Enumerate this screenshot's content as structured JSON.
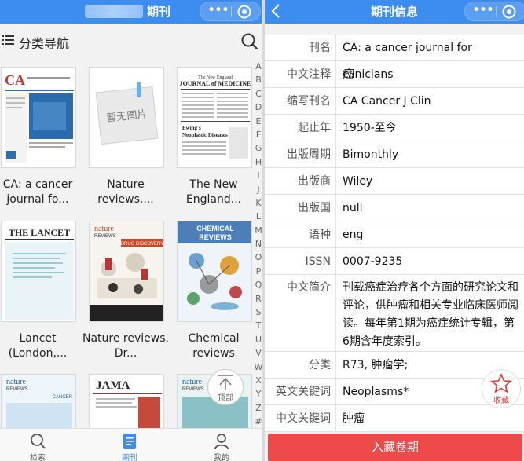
{
  "left": {
    "header": {
      "title": "期刊"
    },
    "nav": {
      "title": "分类导航"
    },
    "journals": [
      {
        "caption": "CA: a cancer journal fo...",
        "cover": "CA"
      },
      {
        "caption": "Nature reviews....",
        "cover": "暂无图片"
      },
      {
        "caption": "The New England...",
        "cover": "The New England JOURNAL of MEDICINE"
      },
      {
        "caption": "Lancet (London,...",
        "cover": "THE LANCET"
      },
      {
        "caption": "Nature reviews. Dr...",
        "cover": "nature REVIEWS DRUG DISCOVERY"
      },
      {
        "caption": "Chemical reviews",
        "cover": "CHEMICAL REVIEWS"
      },
      {
        "caption": "",
        "cover": "nature REVIEWS CANCER"
      },
      {
        "caption": "",
        "cover": "JAMA"
      },
      {
        "caption": "",
        "cover": "nature REVIEWS"
      }
    ],
    "ewing": "Ewing's Neoplastic Diseases",
    "alphabet": [
      "A",
      "B",
      "C",
      "D",
      "E",
      "F",
      "G",
      "H",
      "I",
      "J",
      "K",
      "L",
      "M",
      "N",
      "O",
      "P",
      "Q",
      "R",
      "S",
      "T",
      "U",
      "V",
      "W",
      "X",
      "Y",
      "Z",
      "#"
    ],
    "top_button": "顶部",
    "tabs": [
      {
        "label": "检索",
        "icon": "search-icon"
      },
      {
        "label": "期刊",
        "icon": "document-icon"
      },
      {
        "label": "我的",
        "icon": "user-icon"
      }
    ]
  },
  "right": {
    "header": {
      "title": "期刊信息"
    },
    "fields": [
      {
        "key": "刊名",
        "value": "CA: a cancer journal for clinicians"
      },
      {
        "key": "中文注释",
        "value": "癌"
      },
      {
        "key": "缩写刊名",
        "value": "CA Cancer J Clin"
      },
      {
        "key": "起止年",
        "value": "1950-至今"
      },
      {
        "key": "出版周期",
        "value": "Bimonthly"
      },
      {
        "key": "出版商",
        "value": "Wiley"
      },
      {
        "key": "出版国",
        "value": "null"
      },
      {
        "key": "语种",
        "value": "eng"
      },
      {
        "key": "ISSN",
        "value": "0007-9235"
      },
      {
        "key": "中文简介",
        "value": "刊载癌症治疗各个方面的研究论文和评论，供肿瘤和相关专业临床医师阅读。每年第1期为癌症统计专辑，第6期含年度索引。"
      },
      {
        "key": "分类",
        "value": "R73, 肿瘤学;"
      },
      {
        "key": "英文关键词",
        "value": "Neoplasms*"
      },
      {
        "key": "中文关键词",
        "value": "肿瘤"
      }
    ],
    "fav_label": "收藏",
    "action_button": "入藏卷期"
  },
  "colors": {
    "accent": "#3d8cf0",
    "danger": "#ef4a4a"
  }
}
